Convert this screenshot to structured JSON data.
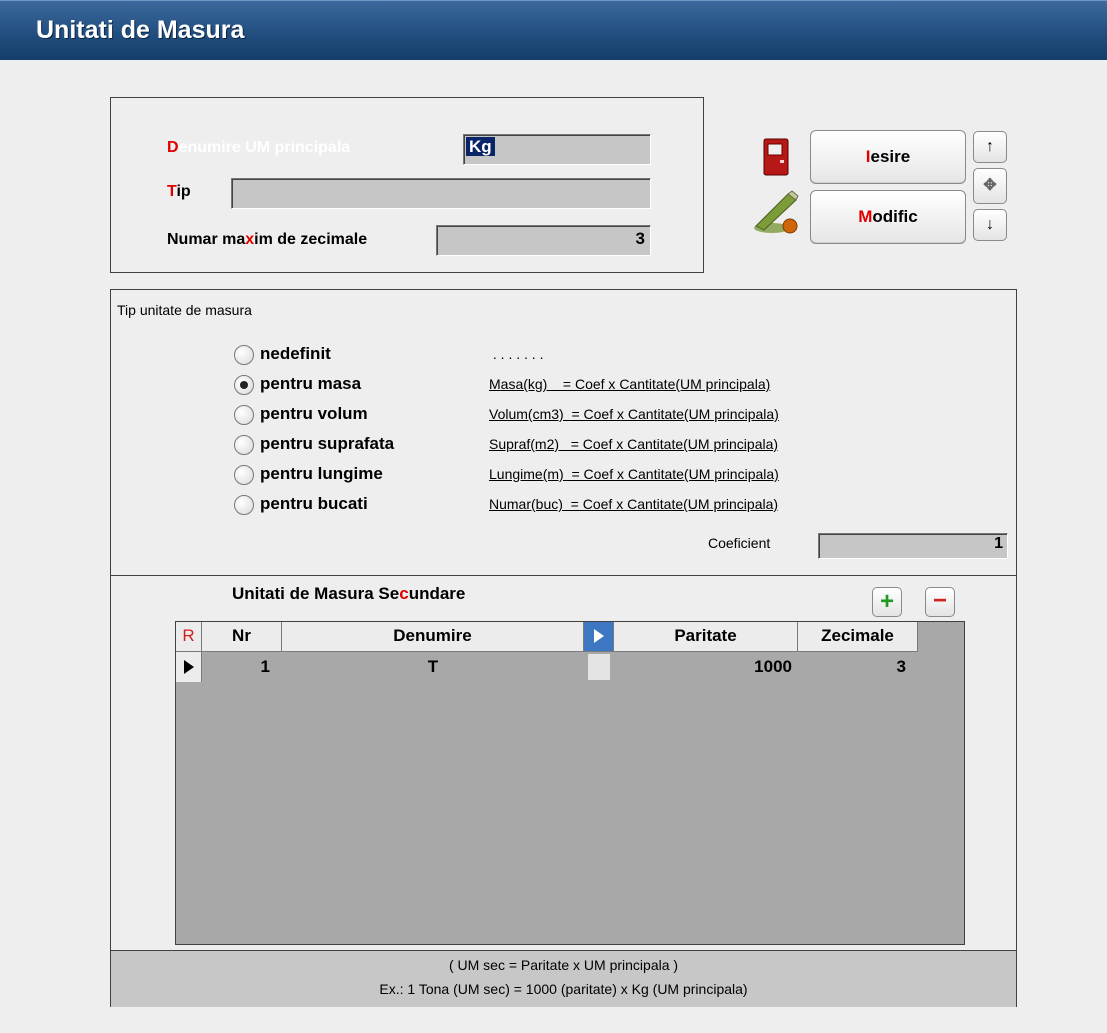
{
  "window": {
    "title": "Unitati de Masura"
  },
  "header_form": {
    "denumire": {
      "label_first": "D",
      "label_rest": "enumire UM principala",
      "value": "Kg"
    },
    "tip": {
      "label_first": "T",
      "label_rest": "ip",
      "value": ""
    },
    "zecimale": {
      "label_pre": "Numar ma",
      "label_hot": "x",
      "label_post": "im de zecimale",
      "value": "3"
    }
  },
  "actions": {
    "exit": {
      "hot": "I",
      "rest": "esire",
      "pre": ""
    },
    "modify": {
      "hot": "M",
      "rest": "odific"
    },
    "nav_up": "↑",
    "nav_center": "✥",
    "nav_down": "↓"
  },
  "type_section": {
    "title": "Tip unitate de masura",
    "options": [
      {
        "label": "nedefinit",
        "formula": " . . . . . . .",
        "selected": false
      },
      {
        "label": "pentru masa",
        "formula": "Masa(kg)    = Coef x Cantitate(UM principala)",
        "selected": true
      },
      {
        "label": "pentru volum",
        "formula": "Volum(cm3)  = Coef x Cantitate(UM principala)",
        "selected": false
      },
      {
        "label": "pentru suprafata",
        "formula": "Supraf(m2)   = Coef x Cantitate(UM principala)",
        "selected": false
      },
      {
        "label": "pentru lungime",
        "formula": "Lungime(m)  = Coef x Cantitate(UM principala)",
        "selected": false
      },
      {
        "label": "pentru bucati",
        "formula": "Numar(buc)  = Coef x Cantitate(UM principala)",
        "selected": false
      }
    ],
    "coef_label": "Coeficient",
    "coef_value": "1"
  },
  "secondary": {
    "title_pre": "Unitati de Masura Se",
    "title_hot": "c",
    "title_post": "undare",
    "add": "+",
    "remove": "−",
    "columns": {
      "r": "R",
      "nr": "Nr",
      "denumire": "Denumire",
      "paritate": "Paritate",
      "zecimale": "Zecimale"
    },
    "rows": [
      {
        "nr": "1",
        "denumire": "T",
        "paritate": "1000",
        "zecimale": "3"
      }
    ]
  },
  "footer": {
    "line1": "( UM sec = Paritate x UM principala )",
    "line2": "Ex.: 1 Tona (UM sec) = 1000 (paritate) x Kg (UM principala)"
  },
  "colors": {
    "title_bar": "#224f80",
    "hotkey": "#e00000",
    "field": "#c6c6c6"
  }
}
